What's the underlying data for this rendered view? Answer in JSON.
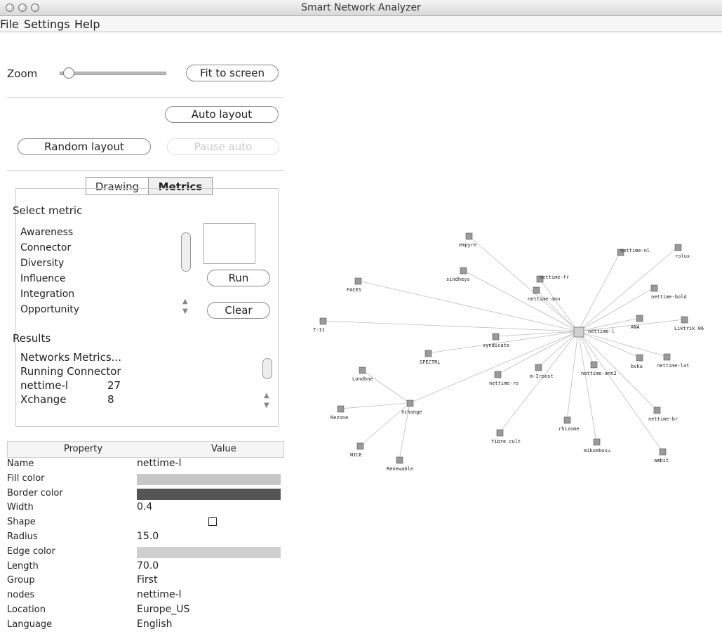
{
  "window": {
    "title": "Smart Network Analyzer"
  },
  "menu": [
    "File",
    "Settings",
    "Help"
  ],
  "controls": {
    "zoom_label": "Zoom",
    "zoom_level": 0.08,
    "fit_to_screen": "Fit to screen",
    "auto_layout": "Auto layout",
    "random_layout": "Random layout",
    "pause_auto": "Pause auto"
  },
  "tabs": [
    {
      "label": "Drawing",
      "active": false
    },
    {
      "label": "Metrics",
      "active": true
    }
  ],
  "metrics": {
    "select_label": "Select metric",
    "items": [
      "Awareness",
      "Connector",
      "Diversity",
      "Influence",
      "Integration",
      "Opportunity"
    ],
    "run": "Run",
    "clear": "Clear",
    "results_label": "Results",
    "results_lines": [
      "Networks Metrics...",
      "Running Connector"
    ],
    "results_rows": [
      {
        "name": "nettime-l",
        "value": "27"
      },
      {
        "name": "Xchange",
        "value": "8"
      }
    ]
  },
  "properties": {
    "header_property": "Property",
    "header_value": "Value",
    "rows": [
      {
        "key": "Name",
        "value": "nettime-l"
      },
      {
        "key": "Fill color",
        "value": ""
      },
      {
        "key": "Border color",
        "value": ""
      },
      {
        "key": "Width",
        "value": "0.4"
      },
      {
        "key": "Shape",
        "value": ""
      },
      {
        "key": "Radius",
        "value": "15.0"
      },
      {
        "key": "Edge color",
        "value": ""
      },
      {
        "key": "Length",
        "value": "70.0"
      },
      {
        "key": "Group",
        "value": "First"
      },
      {
        "key": "nodes",
        "value": "nettime-l"
      },
      {
        "key": "Location",
        "value": "Europe_US"
      },
      {
        "key": "Language",
        "value": "English"
      }
    ],
    "fill_color": "#c7c7c7",
    "border_color": "#555555",
    "edge_color": "#cfcfcf"
  },
  "graph": {
    "center": "nettime-l",
    "nodes": [
      "nettime-l",
      "empyre",
      "rolux",
      "nettime-nl",
      "nettime-fr",
      "nettime-ann",
      "sindheys",
      "FACES",
      "nettime-bold",
      "7-11",
      "ANA",
      "Liktrik 06",
      "syndicate",
      "SPECTRL",
      "nettime-lat",
      "Londhne",
      "nettime-ro",
      "m-Irpost",
      "nettime-ann2",
      "bvku",
      "Xchange",
      "Rezone",
      "NICE",
      "Renewable",
      "fibre cult",
      "rhizome",
      "nettime-br",
      "mikumbusu",
      "ambit"
    ]
  }
}
